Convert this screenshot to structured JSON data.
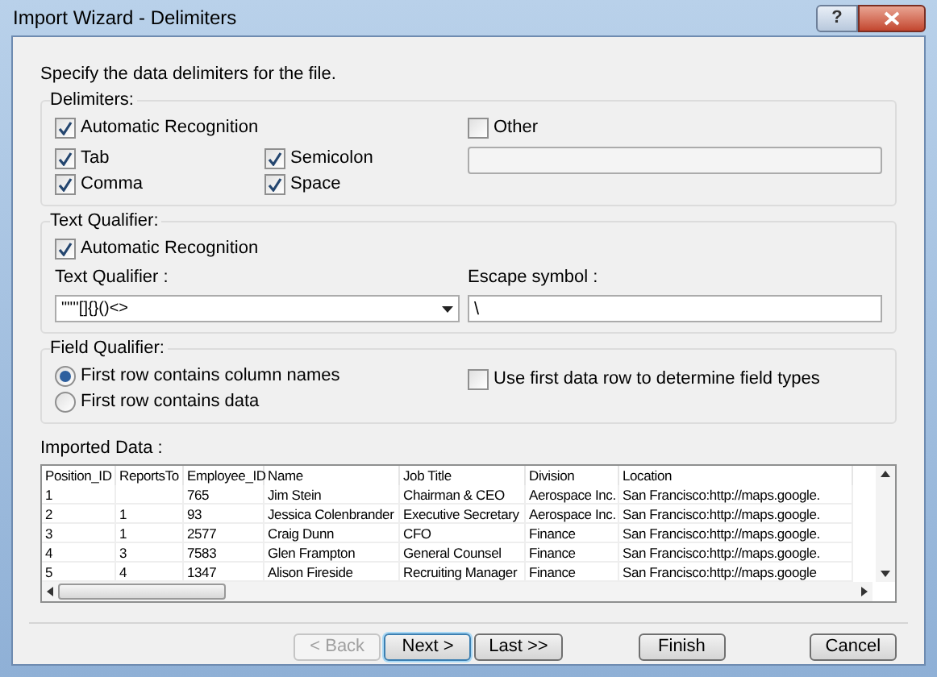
{
  "window": {
    "title": "Import Wizard - Delimiters",
    "help": "?"
  },
  "instruction": "Specify the data delimiters for the file.",
  "delimiters": {
    "legend": "Delimiters:",
    "options": [
      {
        "label": "Automatic Recognition",
        "checked": true
      },
      {
        "label": "Tab",
        "checked": true
      },
      {
        "label": "Semicolon",
        "checked": true
      },
      {
        "label": "Comma",
        "checked": true
      },
      {
        "label": "Space",
        "checked": true
      }
    ],
    "other": {
      "label": "Other",
      "checked": false
    }
  },
  "text_qualifier": {
    "legend": "Text Qualifier:",
    "auto": {
      "label": "Automatic Recognition",
      "checked": true
    },
    "qualifier_label": "Text Qualifier :",
    "qualifier_value": "\"\"''[]{}()<>",
    "escape_label": "Escape symbol :",
    "escape_value": "\\"
  },
  "field_qualifier": {
    "legend": "Field Qualifier:",
    "radios": [
      {
        "label": "First row contains column names",
        "selected": true
      },
      {
        "label": "First row contains data",
        "selected": false
      }
    ],
    "use_first_row": {
      "label": "Use first data row to determine field types",
      "checked": false
    }
  },
  "imported": {
    "label": "Imported Data :",
    "columns": [
      "Position_ID",
      "ReportsTo",
      "Employee_ID",
      "Name",
      "Job Title",
      "Division",
      "Location"
    ],
    "rows": [
      [
        "1",
        "",
        "765",
        "Jim Stein",
        "Chairman & CEO",
        "Aerospace Inc.",
        "San Francisco:http://maps.google."
      ],
      [
        "2",
        "1",
        "93",
        "Jessica Colenbrander",
        "Executive Secretary",
        "Aerospace Inc.",
        "San Francisco:http://maps.google."
      ],
      [
        "3",
        "1",
        "2577",
        "Craig Dunn",
        "CFO",
        "Finance",
        "San Francisco:http://maps.google."
      ],
      [
        "4",
        "3",
        "7583",
        "Glen Frampton",
        "General Counsel",
        "Finance",
        "San Francisco:http://maps.google."
      ],
      [
        "5",
        "4",
        "1347",
        "Alison Fireside",
        "Recruiting Manager",
        "Finance",
        "San Francisco:http://maps.google"
      ]
    ]
  },
  "buttons": [
    {
      "label": "< Back",
      "disabled": true,
      "default": false
    },
    {
      "label": "Next >",
      "disabled": false,
      "default": true
    },
    {
      "label": "Last >>",
      "disabled": false,
      "default": false
    },
    {
      "label": "Finish",
      "disabled": false,
      "default": false
    },
    {
      "label": "Cancel",
      "disabled": false,
      "default": false
    }
  ]
}
